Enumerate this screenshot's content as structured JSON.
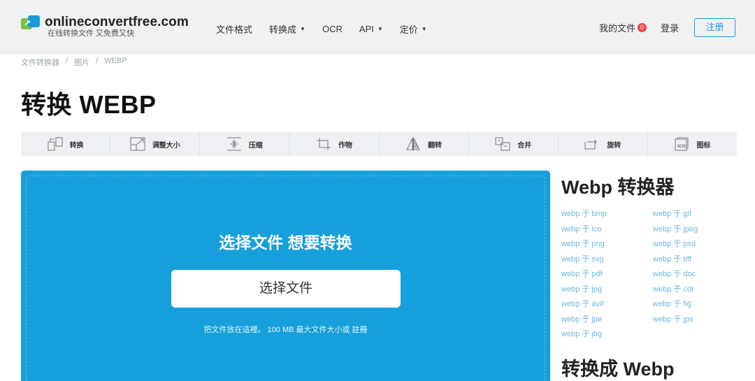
{
  "header": {
    "logo_name": "onlineconvertfree.com",
    "logo_tagline": "在线转换文件 又免费又快",
    "nav": [
      "文件格式",
      "转换成",
      "OCR",
      "API",
      "定价"
    ],
    "nav_dropdown": [
      false,
      true,
      false,
      true,
      true
    ],
    "my_files": "我的文件",
    "my_files_count": "0",
    "login": "登录",
    "register": "注册"
  },
  "breadcrumb": [
    "文件转换器",
    "图片",
    "WEBP"
  ],
  "page_title": "转换 WEBP",
  "tools": [
    {
      "label": "转换",
      "icon": "convert-icon"
    },
    {
      "label": "调整大小",
      "icon": "resize-icon"
    },
    {
      "label": "压缩",
      "icon": "compress-icon"
    },
    {
      "label": "作物",
      "icon": "crop-icon"
    },
    {
      "label": "翻转",
      "icon": "flip-icon"
    },
    {
      "label": "合并",
      "icon": "merge-icon"
    },
    {
      "label": "旋转",
      "icon": "rotate-icon"
    },
    {
      "label": "图标",
      "icon": "ico-icon"
    }
  ],
  "upload": {
    "title": "选择文件 想要转换",
    "button": "选择文件",
    "note": "把文件放在這裡。 100 MB 最大文件大小或",
    "note_link": "註冊"
  },
  "sidebar": {
    "title": "Webp 转换器",
    "links": [
      "webp 于 bmp",
      "webp 于 gif",
      "webp 于 ico",
      "webp 于 jpeg",
      "webp 于 png",
      "webp 于 psd",
      "webp 于 svg",
      "webp 于 tiff",
      "webp 于 pdf",
      "webp 于 doc",
      "webp 于 jpg",
      "webp 于 cdr",
      "webp 于 avif",
      "webp 于 fig",
      "webp 于 jpe",
      "webp 于 jps",
      "webp 于 jbg"
    ],
    "title2": "转换成 Webp"
  },
  "colors": {
    "accent": "#179fdb",
    "link": "#6cb6e4",
    "badge": "#ef4444",
    "header_bg": "#f0f1f3"
  }
}
